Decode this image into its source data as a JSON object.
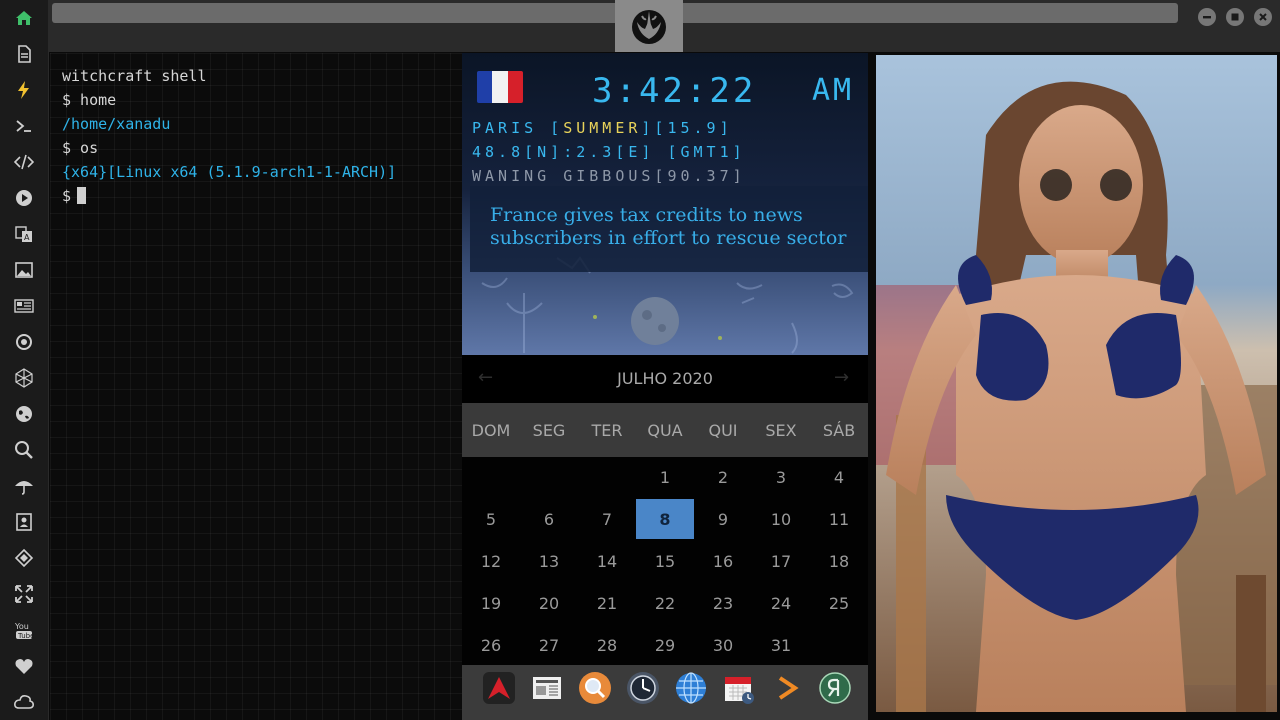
{
  "sidebar": {
    "icons": [
      "home-icon",
      "document-icon",
      "bolt-icon",
      "terminal-icon",
      "code-icon",
      "play-icon",
      "translate-icon",
      "image-icon",
      "news-icon",
      "settings-icon",
      "network-icon",
      "globe-icon",
      "search-icon",
      "umbrella-icon",
      "contacts-icon",
      "pixelate-icon",
      "fullscreen-icon",
      "youtube-icon",
      "heart-icon",
      "cloud-icon"
    ]
  },
  "terminal": {
    "lines": [
      {
        "text": "witchcraft shell",
        "color": "white"
      },
      {
        "text": "$ home",
        "color": "white"
      },
      {
        "text": "/home/xanadu",
        "color": "cyan"
      },
      {
        "text": "$ os",
        "color": "white"
      },
      {
        "text": "{x64}[Linux x64 (5.1.9-arch1-1-ARCH)]",
        "color": "cyan"
      },
      {
        "text": "$",
        "color": "white"
      }
    ]
  },
  "clock": {
    "time": "3:42:22",
    "ampm": "AM",
    "line1_city": "PARIS [",
    "line1_season": "SUMMER",
    "line1_rest": "][15.9]",
    "line2": "48.8[N]:2.3[E] [GMT1]",
    "line3": "WANING GIBBOUS[90.37]",
    "flag_colors": [
      "#1f3fa8",
      "#f2f2f2",
      "#d6202a"
    ],
    "news": "France gives tax credits to news subscribers in effort to rescue sector",
    "season_color": "#e8d35a"
  },
  "calendar": {
    "month": "JULHO 2020",
    "prev": "←",
    "next": "→",
    "days_of_week": [
      "DOM",
      "SEG",
      "TER",
      "QUA",
      "QUI",
      "SEX",
      "SÁB"
    ],
    "first_weekday": 3,
    "num_days": 31,
    "today": 8
  },
  "dock": {
    "icons": [
      "arrow-app-icon",
      "newspaper-app-icon",
      "search-app-icon",
      "clock-app-icon",
      "globe-app-icon",
      "calendar-app-icon",
      "terminal-app-icon",
      "yandex-app-icon"
    ]
  },
  "window": {
    "buttons": [
      "minimize",
      "maximize",
      "close"
    ]
  }
}
